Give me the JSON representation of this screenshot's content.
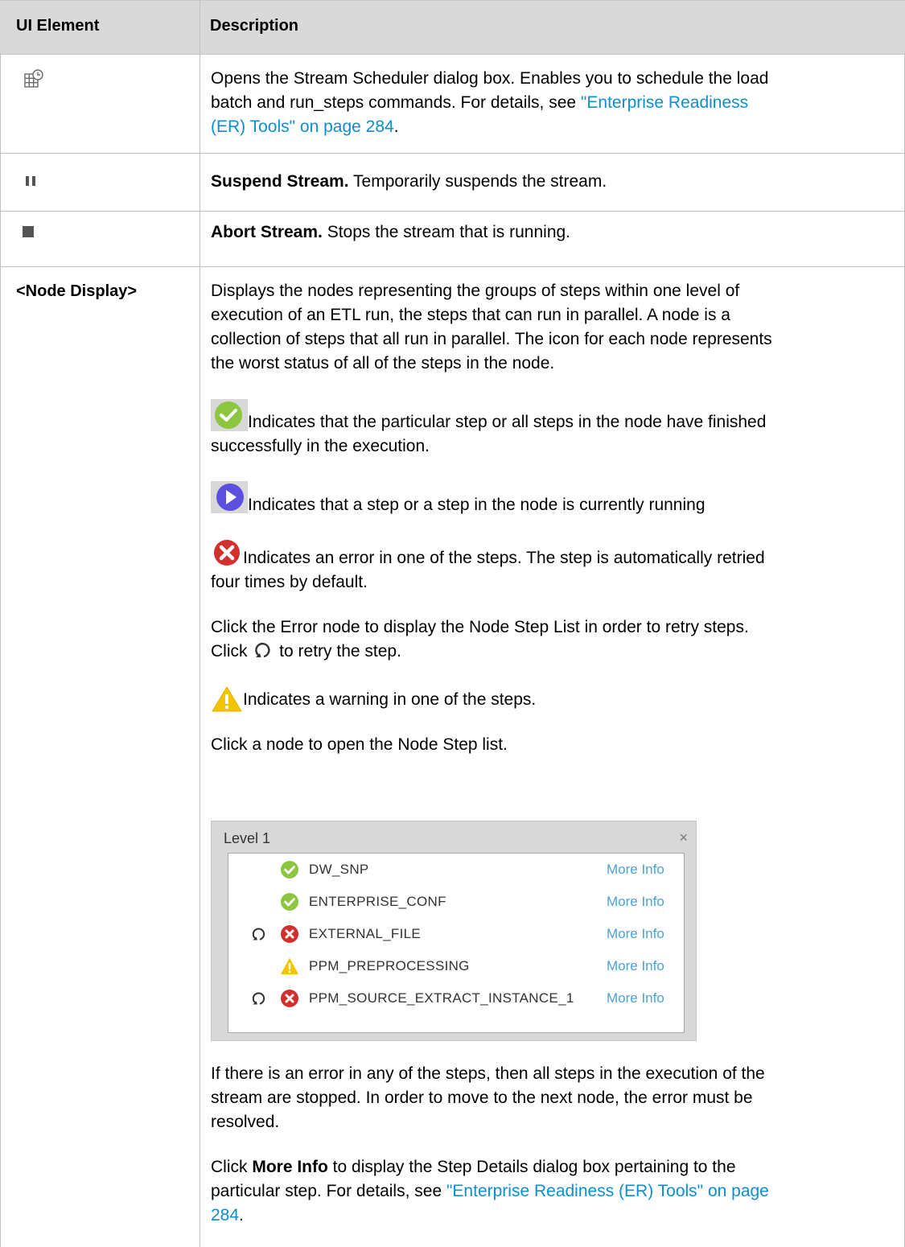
{
  "header": {
    "col1": "UI Element",
    "col2": "Description"
  },
  "rows": {
    "scheduler": {
      "icon": "scheduler-icon",
      "line1": "Opens the Stream Scheduler dialog box. Enables you to schedule the load",
      "line2_pre": "batch and run_steps commands. For details, see ",
      "line2_link": "\"Enterprise Readiness",
      "line3_link": "(ER) Tools\" on page 284",
      "line3_post": "."
    },
    "suspend": {
      "icon": "pause-icon",
      "bold": "Suspend Stream.",
      "text": " Temporarily suspends the stream."
    },
    "abort": {
      "icon": "stop-icon",
      "bold": "Abort Stream.",
      "text": " Stops the stream that is running."
    },
    "node": {
      "element": "<Node Display>",
      "p1": [
        "Displays the nodes representing the groups of steps within one level of",
        "execution of an ETL run, the steps that can run in parallel. A node is a",
        "collection of steps that all run in parallel. The icon for each node represents",
        "the worst status of all of the steps in the node."
      ],
      "success_line1": " Indicates that the particular step or all steps in the node have finished",
      "success_line2": "successfully in the execution.",
      "running": " Indicates that a step or a step in the node is currently running",
      "error_line1": " Indicates an error in one of the steps. The step is automatically retried",
      "error_line2": "four times by default.",
      "click_error_line1": "Click the Error node to display the Node Step List in order to retry steps.",
      "click_pre": "Click ",
      "click_post": " to retry the step.",
      "warning": " Indicates a warning in one of the steps.",
      "click_node": "Click a node to open the Node Step list.",
      "stop_p": [
        "If there is an error in any of the steps, then all steps in the execution of the",
        "stream are stopped. In order to move to the next node, the error must be",
        "resolved."
      ],
      "more_pre": "Click ",
      "more_bold": "More Info",
      "more_post": " to display the Step Details dialog box pertaining to the",
      "more_line2_pre": "particular step. For details, see ",
      "more_line2_link": "\"Enterprise Readiness (ER) Tools\" on page",
      "more_line3_link": "284",
      "more_line3_post": "."
    }
  },
  "dialog": {
    "title": "Level 1",
    "close": "×",
    "rows": [
      {
        "name": "DW_SNP",
        "status": "success",
        "retry": false,
        "more": "More Info"
      },
      {
        "name": "ENTERPRISE_CONF",
        "status": "success",
        "retry": false,
        "more": "More Info"
      },
      {
        "name": "EXTERNAL_FILE",
        "status": "error",
        "retry": true,
        "more": "More Info"
      },
      {
        "name": "PPM_PREPROCESSING",
        "status": "warning",
        "retry": false,
        "more": "More Info"
      },
      {
        "name": "PPM_SOURCE_EXTRACT_INSTANCE_1",
        "status": "error",
        "retry": true,
        "more": "More Info"
      }
    ]
  },
  "colors": {
    "link": "#0b8fcf",
    "success": "#8cc63f",
    "running": "#5b4fe0",
    "error": "#d32f2f",
    "warning": "#f5c400"
  }
}
